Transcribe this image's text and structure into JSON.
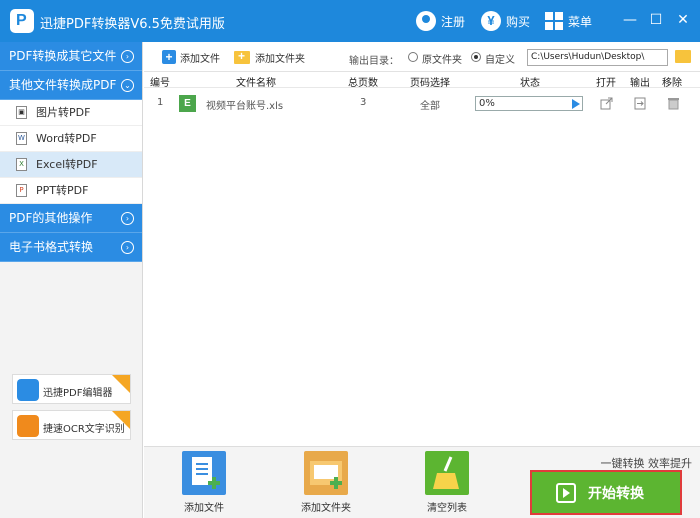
{
  "app": {
    "title": "迅捷PDF转换器V6.5免费试用版",
    "logo_letter": "P",
    "register": "注册",
    "buy": "购买",
    "menu": "菜单",
    "minimize": "—",
    "restore": "☐",
    "close": "✕"
  },
  "sidebar": {
    "categories": [
      {
        "label": "PDF转换成其它文件",
        "chevron": "›"
      },
      {
        "label": "其他文件转换成PDF",
        "chevron": "⌄"
      }
    ],
    "items": [
      {
        "label": "图片转PDF",
        "icon_glyph": "▣",
        "icon": "image-file-icon"
      },
      {
        "label": "Word转PDF",
        "icon_glyph": "W",
        "icon": "word-file-icon"
      },
      {
        "label": "Excel转PDF",
        "icon_glyph": "X",
        "icon": "excel-file-icon",
        "active": true
      },
      {
        "label": "PPT转PDF",
        "icon_glyph": "P",
        "icon": "ppt-file-icon"
      }
    ],
    "bottom_categories": [
      {
        "label": "PDF的其他操作",
        "chevron": "›"
      },
      {
        "label": "电子书格式转换",
        "chevron": "›"
      }
    ],
    "promos": [
      {
        "label": "迅捷PDF编辑器",
        "color": "#2b8ce3"
      },
      {
        "label": "捷速OCR文字识别",
        "color": "#f08a1c"
      }
    ]
  },
  "toolbar": {
    "add_file": "添加文件",
    "add_folder": "添加文件夹",
    "output_label": "输出目录：",
    "radio_original": "原文件夹",
    "radio_custom": "自定义",
    "selected_radio": "自定义",
    "output_path": "C:\\Users\\Hudun\\Desktop\\"
  },
  "table": {
    "headers": [
      "编号",
      "文件名称",
      "总页数",
      "页码选择",
      "状态",
      "打开",
      "输出",
      "移除"
    ],
    "rows": [
      {
        "index": "1",
        "file_icon": "E",
        "filename": "视频平台账号.xls",
        "pages": "3",
        "page_range": "全部",
        "progress": 0,
        "progress_text": "0%"
      }
    ]
  },
  "bottom": {
    "add_file": "添加文件",
    "add_folder": "添加文件夹",
    "clear_list": "清空列表",
    "slogan": "一键转换  效率提升",
    "start": "开始转换"
  },
  "colors": {
    "titlebar": "#1e88dc",
    "sidebar_category": "#2b8ce3",
    "start_button": "#5cb531",
    "highlight_border": "#e03b3b",
    "active_item": "#d8e9f8"
  }
}
